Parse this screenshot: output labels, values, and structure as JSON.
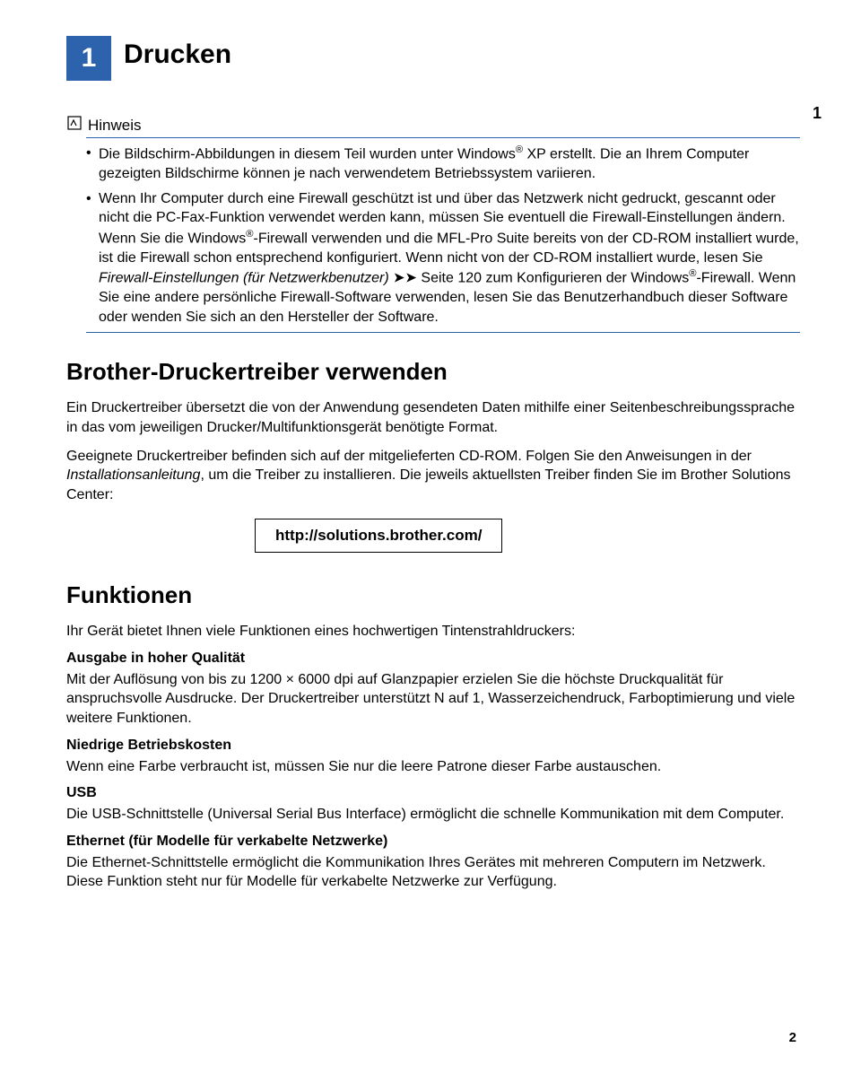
{
  "chapter": {
    "number": "1",
    "title": "Drucken"
  },
  "sidePageNumber": "1",
  "note": {
    "label": "Hinweis",
    "items": [
      {
        "html": "Die Bildschirm-Abbildungen in diesem Teil wurden unter Windows<sup>®</sup> XP erstellt. Die an Ihrem Computer gezeigten Bildschirme können je nach verwendetem Betriebssystem variieren."
      },
      {
        "html": "Wenn Ihr Computer durch eine Firewall geschützt ist und über das Netzwerk nicht gedruckt, gescannt oder nicht die PC-Fax-Funktion verwendet werden kann, müssen Sie eventuell die Firewall-Einstellungen ändern. Wenn Sie die Windows<sup>®</sup>-Firewall verwenden und die MFL-Pro Suite bereits von der CD-ROM installiert wurde, ist die Firewall schon entsprechend konfiguriert. Wenn nicht von der CD-ROM installiert wurde, lesen Sie <span class=\"italic\">Firewall-Einstellungen (für Netzwerkbenutzer)</span> <span class=\"fwd\">&#x27A4;&#x27A4;</span> Seite 120 zum Konfigurieren der Windows<sup>®</sup>-Firewall. Wenn Sie eine andere persönliche Firewall-Software verwenden, lesen Sie das Benutzerhandbuch dieser Software oder wenden Sie sich an den Hersteller der Software."
      }
    ]
  },
  "section1": {
    "heading": "Brother-Druckertreiber verwenden",
    "p1": "Ein Druckertreiber übersetzt die von der Anwendung gesendeten Daten mithilfe einer Seitenbeschreibungssprache in das vom jeweiligen Drucker/Multifunktionsgerät benötigte Format.",
    "p2_html": "Geeignete Druckertreiber befinden sich auf der mitgelieferten CD-ROM. Folgen Sie den Anweisungen in der <span class=\"italic\">Installationsanleitung</span>, um die Treiber zu installieren. Die jeweils aktuellsten Treiber finden Sie im Brother Solutions Center:",
    "url": "http://solutions.brother.com/"
  },
  "section2": {
    "heading": "Funktionen",
    "intro": "Ihr Gerät bietet Ihnen viele Funktionen eines hochwertigen Tintenstrahldruckers:",
    "f1": {
      "title": "Ausgabe in hoher Qualität",
      "body": "Mit der Auflösung von bis zu 1200 × 6000 dpi auf Glanzpapier erzielen Sie die höchste Druckqualität für anspruchsvolle Ausdrucke. Der Druckertreiber unterstützt N auf 1, Wasserzeichendruck, Farboptimierung und viele weitere Funktionen."
    },
    "f2": {
      "title": "Niedrige Betriebskosten",
      "body": "Wenn eine Farbe verbraucht ist, müssen Sie nur die leere Patrone dieser Farbe austauschen."
    },
    "f3": {
      "title": "USB",
      "body": "Die USB-Schnittstelle (Universal Serial Bus Interface) ermöglicht die schnelle Kommunikation mit dem Computer."
    },
    "f4": {
      "title": "Ethernet (für Modelle für verkabelte Netzwerke)",
      "body": "Die Ethernet-Schnittstelle ermöglicht die Kommunikation Ihres Gerätes mit mehreren Computern im Netzwerk. Diese Funktion steht nur für Modelle für verkabelte Netzwerke zur Verfügung."
    }
  },
  "pageNumberBottom": "2"
}
